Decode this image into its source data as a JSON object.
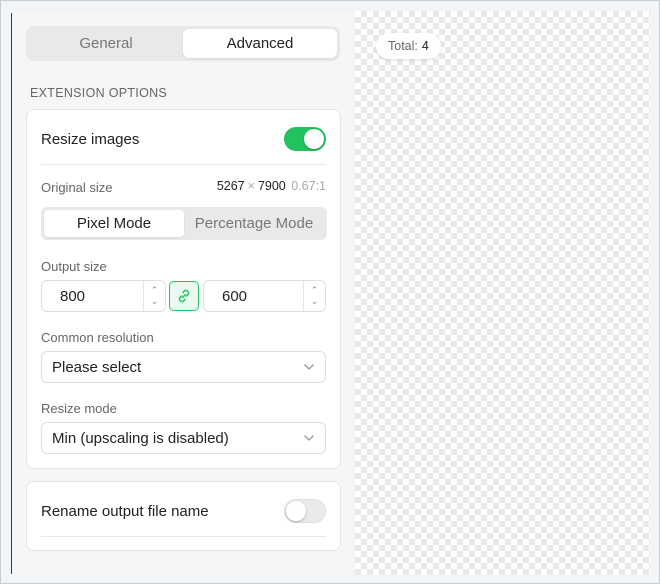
{
  "tabs": {
    "general": "General",
    "advanced": "Advanced"
  },
  "section_title": "EXTENSION OPTIONS",
  "resize": {
    "label": "Resize images",
    "enabled": true,
    "original_size_label": "Original size",
    "original_width": "5267",
    "times": "×",
    "original_height": "7900",
    "ratio": "0.67:1",
    "modes": {
      "pixel": "Pixel Mode",
      "percentage": "Percentage Mode"
    },
    "output_size_label": "Output size",
    "output_width": "800",
    "output_height": "600",
    "common_resolution_label": "Common resolution",
    "common_resolution_value": "Please select",
    "resize_mode_label": "Resize mode",
    "resize_mode_value": "Min (upscaling is disabled)"
  },
  "rename": {
    "label": "Rename output file name",
    "enabled": false
  },
  "preview": {
    "total_label": "Total:",
    "total_count": "4"
  },
  "colors": {
    "accent": "#22c35e",
    "toggle_off": "#e9eaec"
  },
  "icons": [
    "link-icon",
    "chevron-down-icon",
    "caret-up-icon",
    "caret-down-icon"
  ]
}
